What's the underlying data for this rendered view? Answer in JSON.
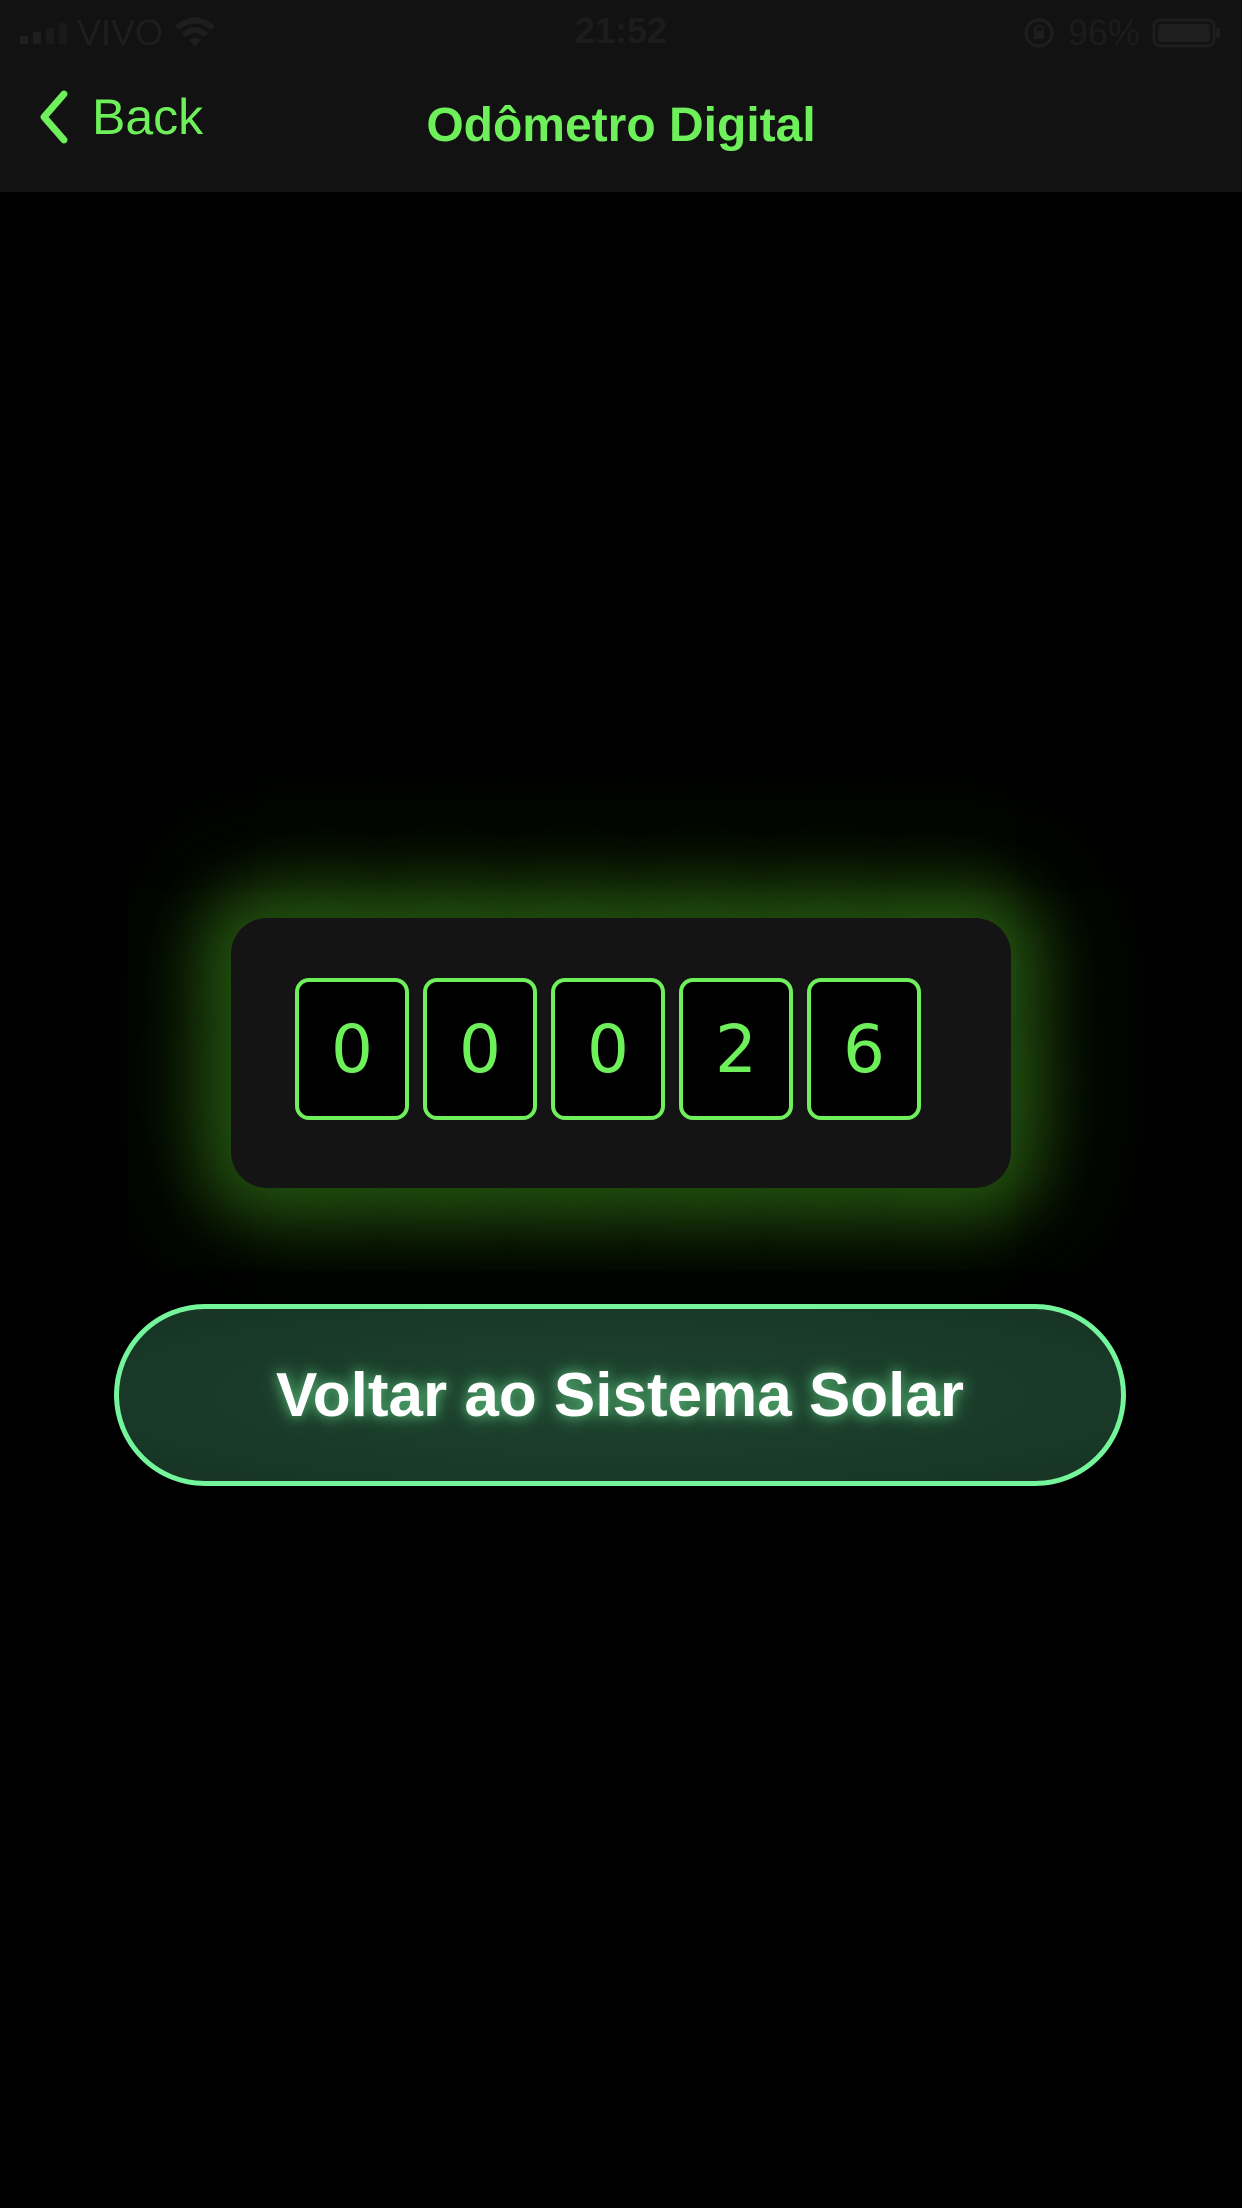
{
  "status_bar": {
    "carrier": "VIVO",
    "time": "21:52",
    "battery_percent": "96%",
    "icons": [
      "signal-icon",
      "wifi-icon",
      "rotation-lock-icon",
      "battery-icon"
    ]
  },
  "nav": {
    "back_label": "Back",
    "title": "Odômetro Digital"
  },
  "odometer": {
    "digits": [
      "0",
      "0",
      "0",
      "2",
      "6"
    ]
  },
  "actions": {
    "solar_button_label": "Voltar ao Sistema Solar"
  },
  "colors": {
    "accent_green": "#6ef05a",
    "button_border": "#74f59c",
    "button_fill": "#1a3a29",
    "background": "#000000",
    "bar_background": "#121212"
  }
}
